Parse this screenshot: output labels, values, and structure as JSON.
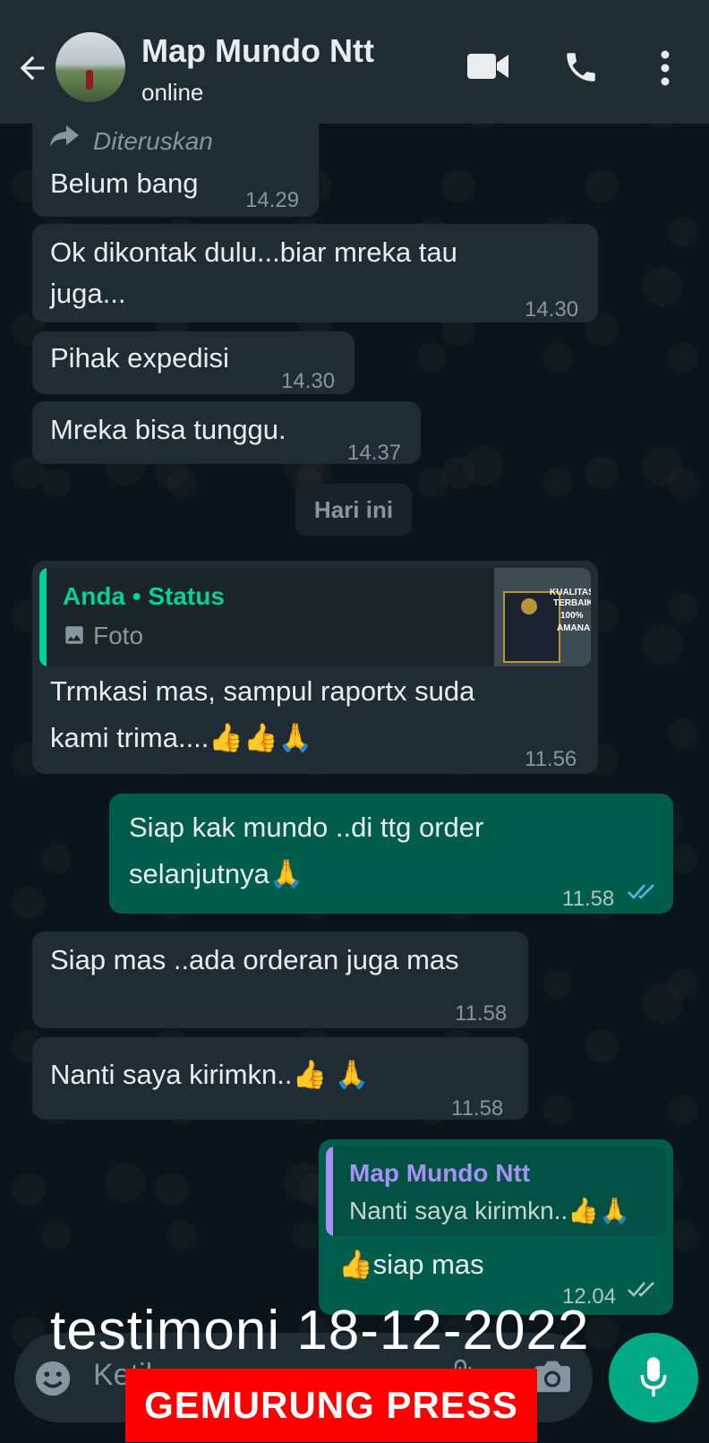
{
  "header": {
    "contact_name": "Map Mundo Ntt",
    "status": "online",
    "icons": [
      "back-arrow-icon",
      "video-call-icon",
      "voice-call-icon",
      "more-vert-icon"
    ]
  },
  "messages": {
    "m1": {
      "forward_label": "Diteruskan",
      "text": "Belum bang",
      "time": "14.29"
    },
    "m2": {
      "line1": "Ok dikontak dulu...biar mreka tau",
      "line2": "juga...",
      "time": "14.30"
    },
    "m3": {
      "text": "Pihak expedisi",
      "time": "14.30"
    },
    "m4": {
      "text": "Mreka bisa tunggu.",
      "time": "14.37"
    },
    "date_chip": "Hari ini",
    "m5": {
      "quote_author": "Anda • Status",
      "quote_type": "Foto",
      "thumb_text": [
        "KUALITAS",
        "TERBAIK",
        "100%",
        "AMANAH"
      ],
      "line1": "Trmkasi mas, sampul raportx suda",
      "line2": "kami trima....",
      "emoji": "👍👍🙏",
      "time": "11.56"
    },
    "m6": {
      "line1": "Siap kak mundo ..di ttg order",
      "line2": "selanjutnya",
      "emoji": "🙏",
      "time": "11.58",
      "status": "read"
    },
    "m7": {
      "text": "Siap mas ..ada orderan juga mas",
      "time": "11.58"
    },
    "m8": {
      "text": "Nanti saya kirimkn..",
      "emoji": "👍 🙏",
      "time": "11.58"
    },
    "m9": {
      "quote_author": "Map Mundo Ntt",
      "quote_text": "Nanti saya kirimkn..",
      "quote_emoji": "👍🙏",
      "emoji": "👍",
      "text": "siap mas",
      "time": "12.04",
      "status": "delivered"
    }
  },
  "input": {
    "placeholder": "Ketik"
  },
  "overlay": {
    "caption": "testimoni 18-12-2022",
    "banner": "GEMURUNG PRESS"
  },
  "colors": {
    "header_bg": "#1f2c34",
    "incoming_bubble": "#202c33",
    "outgoing_bubble": "#005c4b",
    "quote_green": "#06cf9c",
    "quote_purple": "#a791f5",
    "read_ticks": "#53bdeb",
    "banner": "#ff0000"
  }
}
